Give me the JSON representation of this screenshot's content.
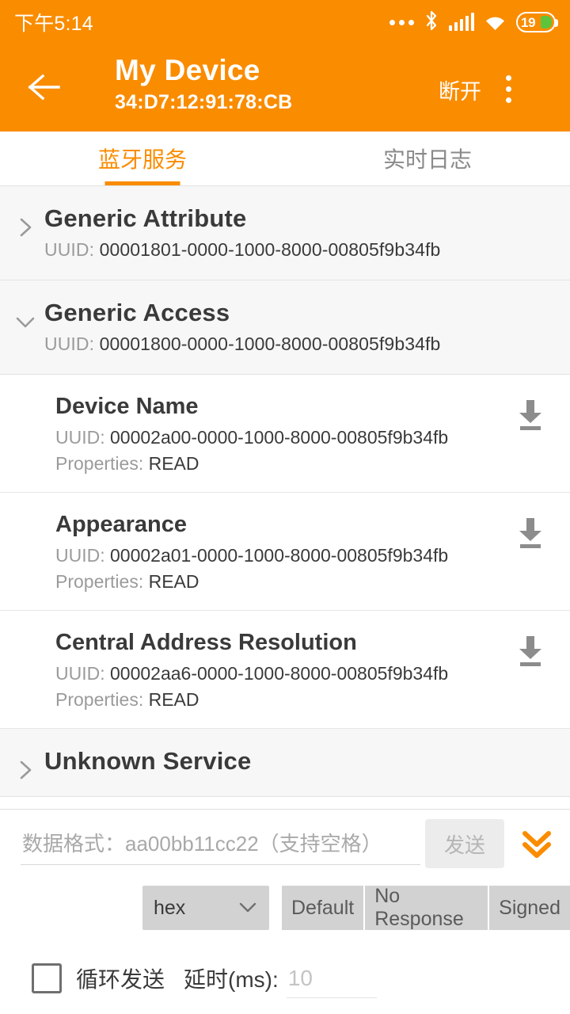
{
  "status_bar": {
    "time": "下午5:14",
    "battery_percent": "19",
    "icons": [
      "more-dots-icon",
      "bluetooth-icon",
      "signal-icon",
      "wifi-icon",
      "battery-icon"
    ]
  },
  "app_bar": {
    "back_icon": "back-arrow-icon",
    "title": "My Device",
    "subtitle": "34:D7:12:91:78:CB",
    "disconnect_label": "断开",
    "overflow_icon": "overflow-menu-icon",
    "background_color": "#FA8C00"
  },
  "tabs": [
    {
      "label": "蓝牙服务",
      "active": true
    },
    {
      "label": "实时日志",
      "active": false
    }
  ],
  "list": {
    "uuid_prefix": "UUID: ",
    "properties_prefix": "Properties: ",
    "items": [
      {
        "kind": "service",
        "name": "Generic Attribute",
        "uuid": "00001801-0000-1000-8000-00805f9b34fb",
        "expanded": false,
        "chevron": "chevron-right-icon"
      },
      {
        "kind": "service",
        "name": "Generic Access",
        "uuid": "00001800-0000-1000-8000-00805f9b34fb",
        "expanded": true,
        "chevron": "chevron-down-icon"
      },
      {
        "kind": "characteristic",
        "name": "Device Name",
        "uuid": "00002a00-0000-1000-8000-00805f9b34fb",
        "properties": "READ",
        "action_icon": "download-icon"
      },
      {
        "kind": "characteristic",
        "name": "Appearance",
        "uuid": "00002a01-0000-1000-8000-00805f9b34fb",
        "properties": "READ",
        "action_icon": "download-icon"
      },
      {
        "kind": "characteristic",
        "name": "Central Address Resolution",
        "uuid": "00002aa6-0000-1000-8000-00805f9b34fb",
        "properties": "READ",
        "action_icon": "download-icon"
      },
      {
        "kind": "service",
        "name": "Unknown Service",
        "uuid": "",
        "expanded": false,
        "chevron": "chevron-right-icon"
      }
    ]
  },
  "bottom_panel": {
    "input_placeholder": "数据格式：aa00bb11cc22（支持空格）",
    "input_value": "",
    "send_label": "发送",
    "send_enabled": false,
    "collapse_icon": "double-chevron-down-icon",
    "format_select": {
      "value": "hex",
      "caret_icon": "chevron-down-icon"
    },
    "write_modes": [
      "Default",
      "No Response",
      "Signed"
    ],
    "loop_checkbox": {
      "label": "循环发送",
      "checked": false
    },
    "delay_label": "延时(ms):",
    "delay_placeholder": "10",
    "delay_value": ""
  },
  "colors": {
    "accent": "#FA8C00",
    "service_bg": "#f7f7f7",
    "text": "#3a3a3a",
    "muted": "#9b9b9b"
  }
}
